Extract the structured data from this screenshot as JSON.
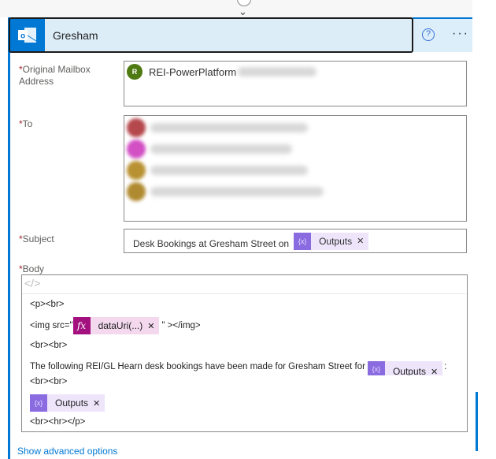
{
  "header": {
    "title": "Gresham",
    "icon": "outlook-icon",
    "help_icon": "help-icon",
    "more_icon": "more-icon"
  },
  "fields": {
    "mailbox": {
      "label": "Original Mailbox Address",
      "required": "*",
      "avatar_letter": "R",
      "value": "REI-PowerPlatform"
    },
    "to": {
      "label": "To",
      "required": "*"
    },
    "subject": {
      "label": "Subject",
      "required": "*",
      "text": "Desk Bookings at Gresham Street on",
      "token": "Outputs"
    },
    "body": {
      "label": "Body",
      "required": "*",
      "code_icon": "</>",
      "lines": {
        "l1": "<p><br>",
        "l2a": "<img src=\"",
        "fx_token": "dataUri(...)",
        "l2b": "\" ></img>",
        "l3": "<br><br>",
        "l4": "The following REI/GL Hearn desk bookings have been made for Gresham Street for",
        "l4_token": "Outputs",
        "l4_end": ":",
        "l5": "<br><br>",
        "l6_token": "Outputs",
        "l7": "<br><hr></p>"
      }
    }
  },
  "advanced_link": "Show advanced options",
  "colors": {
    "accent": "#0078d4",
    "variable_token": "#8a6be0",
    "expression_token": "#a3117f"
  }
}
